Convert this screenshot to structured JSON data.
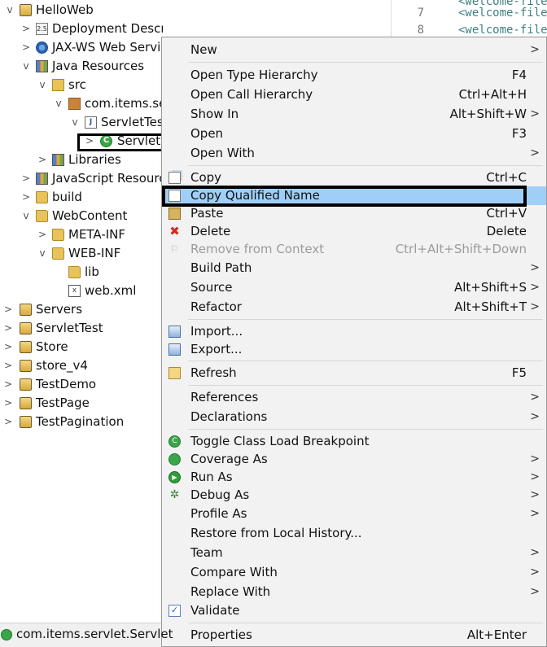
{
  "explorer": {
    "rows": [
      {
        "label": "HelloWeb",
        "twisty": "v",
        "icon": "project-icon"
      },
      {
        "label": "Deployment Descriptor: HelloWeb",
        "twisty": ">",
        "icon": "deployment-descriptor-icon"
      },
      {
        "label": "JAX-WS Web Services",
        "twisty": ">",
        "icon": "web-services-icon"
      },
      {
        "label": "Java Resources",
        "twisty": "v",
        "icon": "java-resources-icon"
      },
      {
        "label": "src",
        "twisty": "v",
        "icon": "source-folder-icon"
      },
      {
        "label": "com.items.servlet",
        "twisty": "v",
        "icon": "package-icon"
      },
      {
        "label": "ServletTest.java",
        "twisty": "v",
        "icon": "java-file-icon"
      },
      {
        "label": "Servlet",
        "twisty": ">",
        "icon": "class-icon"
      },
      {
        "label": "Libraries",
        "twisty": ">",
        "icon": "libraries-icon"
      },
      {
        "label": "JavaScript Resources",
        "twisty": ">",
        "icon": "javascript-resources-icon"
      },
      {
        "label": "build",
        "twisty": ">",
        "icon": "folder-icon"
      },
      {
        "label": "WebContent",
        "twisty": "v",
        "icon": "folder-icon"
      },
      {
        "label": "META-INF",
        "twisty": ">",
        "icon": "folder-icon"
      },
      {
        "label": "WEB-INF",
        "twisty": "v",
        "icon": "folder-icon"
      },
      {
        "label": "lib",
        "twisty": "",
        "icon": "folder-icon"
      },
      {
        "label": "web.xml",
        "twisty": "",
        "icon": "xml-file-icon"
      },
      {
        "label": "Servers",
        "twisty": ">",
        "icon": "project-icon"
      },
      {
        "label": "ServletTest",
        "twisty": ">",
        "icon": "project-icon"
      },
      {
        "label": "Store",
        "twisty": ">",
        "icon": "project-icon"
      },
      {
        "label": "store_v4",
        "twisty": ">",
        "icon": "project-icon"
      },
      {
        "label": "TestDemo",
        "twisty": ">",
        "icon": "project-icon"
      },
      {
        "label": "TestPage",
        "twisty": ">",
        "icon": "project-icon"
      },
      {
        "label": "TestPagination",
        "twisty": ">",
        "icon": "project-icon"
      }
    ],
    "selected_label": "Servlet"
  },
  "editor": {
    "lines": [
      {
        "num": "",
        "code": "<welcome-file"
      },
      {
        "num": "7",
        "code": "<welcome-file"
      },
      {
        "num": "8",
        "code": "<welcome-file"
      }
    ]
  },
  "context_menu": {
    "items": [
      {
        "label": "New",
        "accel": "",
        "submenu": true,
        "icon": ""
      },
      {
        "label": "Open Type Hierarchy",
        "accel": "F4",
        "submenu": false,
        "icon": ""
      },
      {
        "label": "Open Call Hierarchy",
        "accel": "Ctrl+Alt+H",
        "submenu": false,
        "icon": ""
      },
      {
        "label": "Show In",
        "accel": "Alt+Shift+W",
        "submenu": true,
        "icon": ""
      },
      {
        "label": "Open",
        "accel": "F3",
        "submenu": false,
        "icon": ""
      },
      {
        "label": "Open With",
        "accel": "",
        "submenu": true,
        "icon": ""
      },
      {
        "label": "Copy",
        "accel": "Ctrl+C",
        "submenu": false,
        "icon": "copy-icon"
      },
      {
        "label": "Copy Qualified Name",
        "accel": "",
        "submenu": false,
        "icon": "copy-qualified-name-icon",
        "highlighted": true
      },
      {
        "label": "Paste",
        "accel": "Ctrl+V",
        "submenu": false,
        "icon": "paste-icon"
      },
      {
        "label": "Delete",
        "accel": "Delete",
        "submenu": false,
        "icon": "delete-icon"
      },
      {
        "label": "Remove from Context",
        "accel": "Ctrl+Alt+Shift+Down",
        "submenu": false,
        "icon": "remove-from-context-icon",
        "disabled": true
      },
      {
        "label": "Build Path",
        "accel": "",
        "submenu": true,
        "icon": ""
      },
      {
        "label": "Source",
        "accel": "Alt+Shift+S",
        "submenu": true,
        "icon": ""
      },
      {
        "label": "Refactor",
        "accel": "Alt+Shift+T",
        "submenu": true,
        "icon": ""
      },
      {
        "label": "Import...",
        "accel": "",
        "submenu": false,
        "icon": "import-icon"
      },
      {
        "label": "Export...",
        "accel": "",
        "submenu": false,
        "icon": "export-icon"
      },
      {
        "label": "Refresh",
        "accel": "F5",
        "submenu": false,
        "icon": "refresh-icon"
      },
      {
        "label": "References",
        "accel": "",
        "submenu": true,
        "icon": ""
      },
      {
        "label": "Declarations",
        "accel": "",
        "submenu": true,
        "icon": ""
      },
      {
        "label": "Toggle Class Load Breakpoint",
        "accel": "",
        "submenu": false,
        "icon": "class-load-breakpoint-icon"
      },
      {
        "label": "Coverage As",
        "accel": "",
        "submenu": true,
        "icon": "coverage-icon"
      },
      {
        "label": "Run As",
        "accel": "",
        "submenu": true,
        "icon": "run-icon"
      },
      {
        "label": "Debug As",
        "accel": "",
        "submenu": true,
        "icon": "debug-icon"
      },
      {
        "label": "Profile As",
        "accel": "",
        "submenu": true,
        "icon": ""
      },
      {
        "label": "Restore from Local History...",
        "accel": "",
        "submenu": false,
        "icon": ""
      },
      {
        "label": "Team",
        "accel": "",
        "submenu": true,
        "icon": ""
      },
      {
        "label": "Compare With",
        "accel": "",
        "submenu": true,
        "icon": ""
      },
      {
        "label": "Replace With",
        "accel": "",
        "submenu": true,
        "icon": ""
      },
      {
        "label": "Validate",
        "accel": "",
        "submenu": false,
        "icon": "validate-icon"
      },
      {
        "label": "Properties",
        "accel": "Alt+Enter",
        "submenu": false,
        "icon": ""
      }
    ],
    "submenu_arrow": ">"
  },
  "status_bar": {
    "text": "com.items.servlet.Servlet"
  },
  "colors": {
    "highlight": "#9fcff7",
    "menu_background": "#f2f2f2",
    "annotation_box": "#000000"
  }
}
